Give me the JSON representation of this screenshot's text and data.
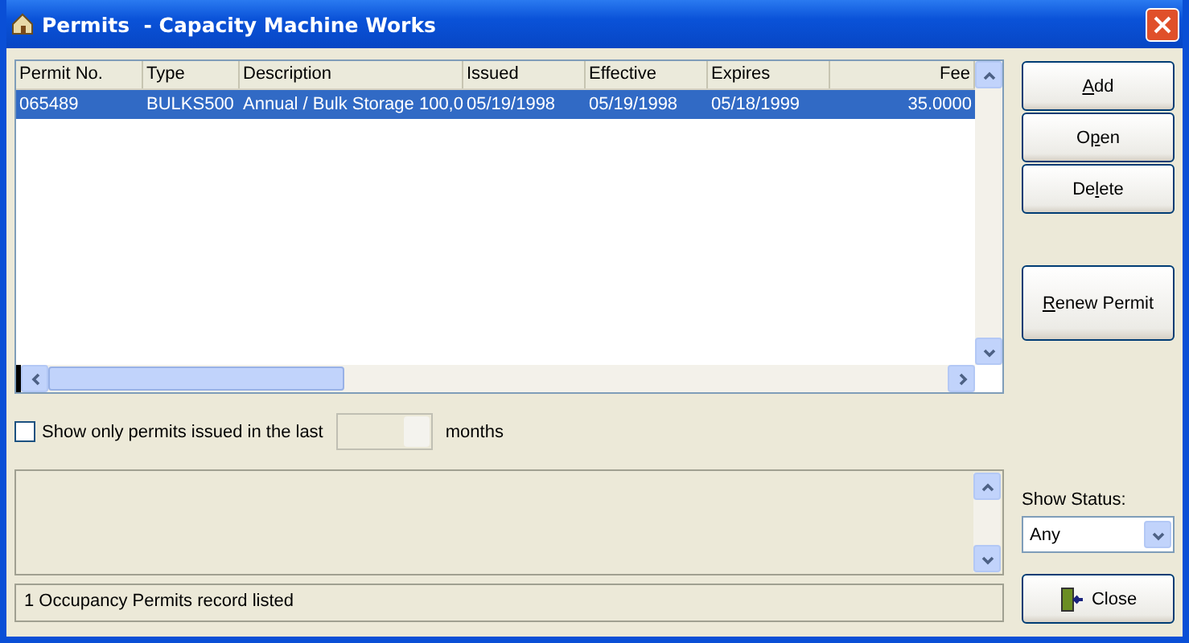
{
  "window": {
    "title": "Permits  - Capacity Machine Works"
  },
  "table": {
    "columns": [
      "Permit No.",
      "Type",
      "Description",
      "Issued",
      "Effective",
      "Expires",
      "Fee"
    ],
    "rows": [
      {
        "selected": true,
        "cells": [
          "065489",
          "BULKS500",
          "Annual / Bulk Storage 100,0",
          "05/19/1998",
          "05/19/1998",
          "05/18/1999",
          "35.0000"
        ]
      }
    ]
  },
  "filter": {
    "checked": false,
    "label": "Show only permits issued in the last",
    "suffix": "months"
  },
  "buttons": [
    {
      "key": "A",
      "after": "dd"
    },
    {
      "before": "O",
      "key": "p",
      "after": "en"
    },
    {
      "before": "De",
      "key": "l",
      "after": "ete"
    }
  ],
  "renew": {
    "key": "R",
    "after": "enew Permit"
  },
  "status_filter": {
    "label": "Show Status:",
    "value": "Any"
  },
  "status_bar": "1 Occupancy Permits record listed",
  "close": "Close"
}
